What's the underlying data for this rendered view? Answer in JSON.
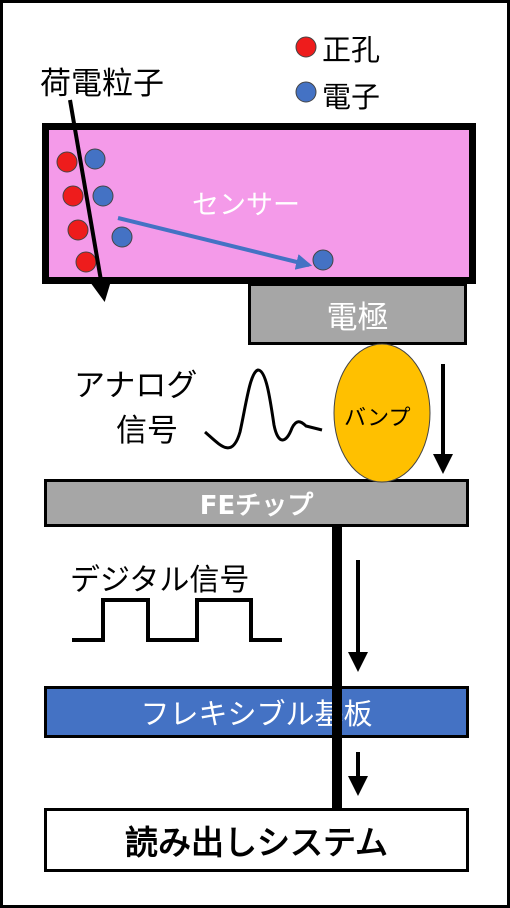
{
  "legend": {
    "hole_label": "正孔",
    "electron_label": "電子",
    "hole_color": "#ee1c1c",
    "electron_color": "#4472c4"
  },
  "charged_particle_label": "荷電粒子",
  "sensor": {
    "label": "センサー",
    "fill": "#f49ae9"
  },
  "electrode": {
    "label": "電極",
    "fill": "#a6a6a6"
  },
  "analog_signal_label_line1": "アナログ",
  "analog_signal_label_line2": "信号",
  "bump": {
    "label": "バンプ",
    "fill": "#ffc000"
  },
  "fe_chip": {
    "label": "FEチップ",
    "fill": "#a6a6a6"
  },
  "digital_signal_label": "デジタル信号",
  "flex_board": {
    "label": "フレキシブル基板",
    "fill": "#4472c4"
  },
  "readout_system": {
    "label": "読み出しシステム"
  }
}
